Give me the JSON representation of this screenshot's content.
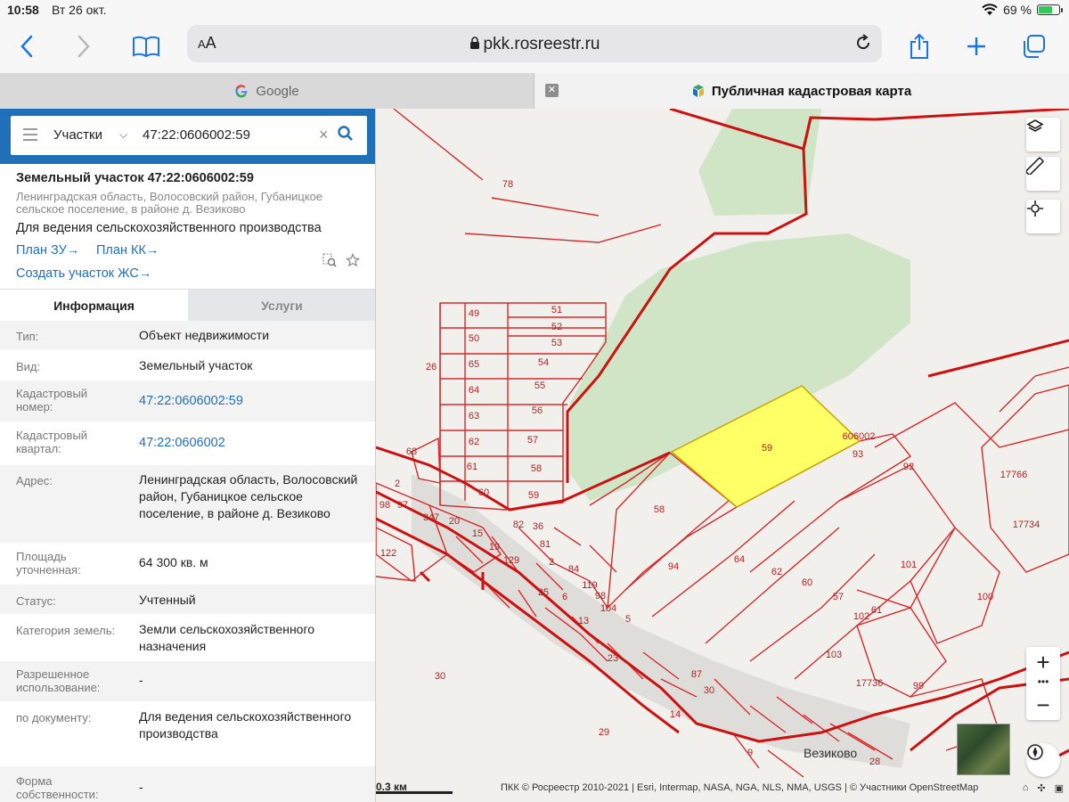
{
  "status": {
    "time": "10:58",
    "date": "Вт 26 окт.",
    "battery": "69 %",
    "battery_level": 0.69
  },
  "browser": {
    "url": "pkk.rosreestr.ru",
    "aa_label": "AA",
    "tabs": [
      {
        "title": "Google"
      },
      {
        "title": "Публичная кадастровая карта"
      }
    ]
  },
  "search": {
    "category": "Участки",
    "query": "47:22:0606002:59"
  },
  "parcel": {
    "title": "Земельный участок 47:22:0606002:59",
    "address_short": "Ленинградская область, Волосовский район, Губаницкое сельское поселение, в районе д. Везиково",
    "use": "Для ведения сельскохозяйственного производства",
    "link_plan_zu": "План ЗУ",
    "link_plan_kk": "План КК",
    "link_create": "Создать участок ЖС"
  },
  "info_tabs": {
    "info": "Информация",
    "services": "Услуги"
  },
  "info_rows": [
    {
      "key": "Тип:",
      "value": "Объект недвижимости"
    },
    {
      "key": "Вид:",
      "value": "Земельный участок"
    },
    {
      "key": "Кадастровый номер:",
      "value": "47:22:0606002:59"
    },
    {
      "key": "Кадастровый квартал:",
      "value": "47:22:0606002"
    },
    {
      "key": "Адрес:",
      "value": "Ленинградская область, Волосовский район, Губаницкое сельское поселение, в районе д. Везиково"
    },
    {
      "key": "Площадь уточненная:",
      "value": "64 300 кв. м"
    },
    {
      "key": "Статус:",
      "value": "Учтенный"
    },
    {
      "key": "Категория земель:",
      "value": "Земли сельскохозяйственного назначения"
    },
    {
      "key": "Разрешенное использование:",
      "value": "-"
    },
    {
      "key": "по документу:",
      "value": "Для ведения сельскохозяйственного производства"
    },
    {
      "key": "Форма собственности:",
      "value": "-"
    }
  ],
  "map": {
    "parcel_labels": [
      "78",
      "49",
      "50",
      "65",
      "64",
      "63",
      "62",
      "61",
      "60",
      "51",
      "52",
      "53",
      "54",
      "55",
      "56",
      "57",
      "58",
      "59",
      "26",
      "68",
      "2",
      "98",
      "97",
      "347",
      "20",
      "15",
      "19",
      "129",
      "82",
      "36",
      "81",
      "2",
      "84",
      "119",
      "98",
      "104",
      "5",
      "122",
      "6",
      "25",
      "13",
      "23",
      "87",
      "30",
      "14",
      "9",
      "28",
      "59",
      "606002",
      "93",
      "92",
      "17766",
      "17734",
      "58",
      "94",
      "64",
      "62",
      "60",
      "57",
      "101",
      "100",
      "102",
      "61",
      "103",
      "17736",
      "99",
      "30",
      "29"
    ],
    "village_label": "Везиково",
    "scale_label": "0.3 км",
    "attribution": "ПКК © Росреестр 2010-2021 | Esri, Intermap, NASA, NGA, NLS, NMA, USGS | © Участники OpenStreetMap",
    "highlight_color": "#ffff66",
    "boundary_color": "#d42a2a",
    "forest_color": "#cfe5c6"
  }
}
